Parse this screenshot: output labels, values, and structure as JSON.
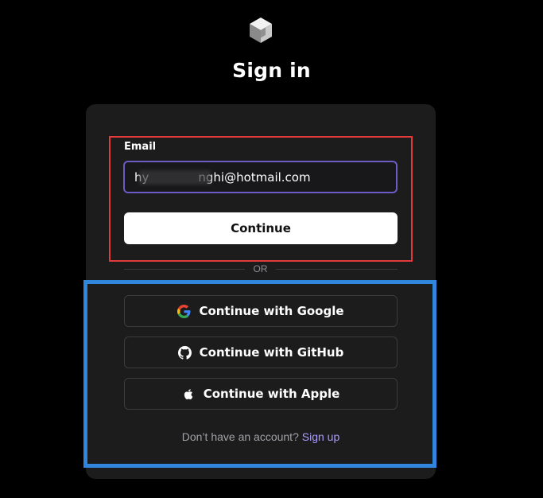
{
  "icons": {
    "logo": "cube-logo-icon",
    "google": "google-icon",
    "github": "github-icon",
    "apple": "apple-icon"
  },
  "colors": {
    "background": "#000000",
    "card": "#1c1c1d",
    "input_border": "#6b5bc4",
    "link": "#a89bff",
    "highlight_red": "#e23a3a",
    "highlight_blue": "#2f86dc"
  },
  "header": {
    "title": "Sign in"
  },
  "form": {
    "email_label": "Email",
    "email_value": "hy             nghi@hotmail.com",
    "continue_label": "Continue"
  },
  "divider": {
    "text": "OR"
  },
  "oauth": {
    "google_label": "Continue with Google",
    "github_label": "Continue with GitHub",
    "apple_label": "Continue with Apple"
  },
  "footer": {
    "prompt": "Don’t have an account?",
    "signup_label": "Sign up"
  }
}
